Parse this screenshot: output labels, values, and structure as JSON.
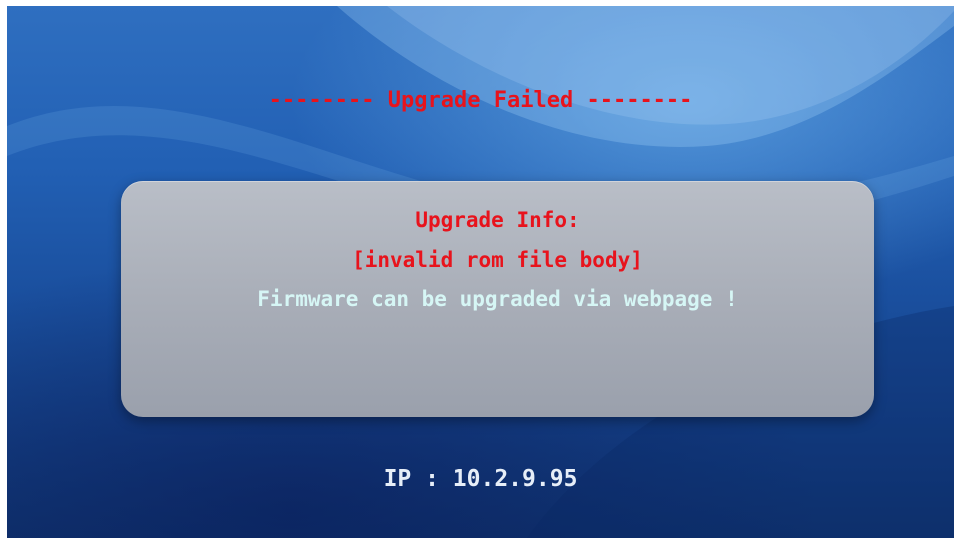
{
  "screen": {
    "title": "-------- Upgrade Failed --------",
    "info_heading": "Upgrade Info:",
    "error_detail": "[invalid rom file body]",
    "hint": "Firmware can be upgraded via webpage !",
    "ip_label": "IP : 10.2.9.95"
  },
  "colors": {
    "error_text": "#e8131c",
    "hint_text": "#d6f6f5",
    "ip_text": "#e6eef8",
    "panel": "#aab0ba",
    "background": "#1f5aa8"
  }
}
